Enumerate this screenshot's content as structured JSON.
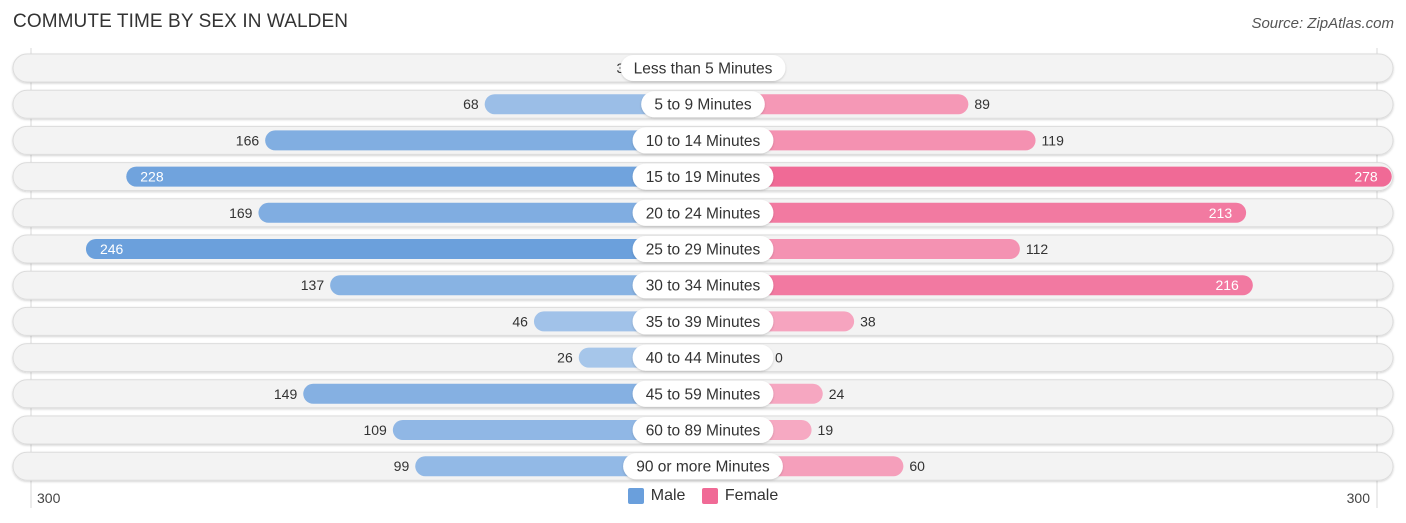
{
  "header": {
    "title": "COMMUTE TIME BY SEX IN WALDEN",
    "source": "Source: ZipAtlas.com"
  },
  "chart_data": {
    "type": "bar",
    "orientation": "horizontal-diverging",
    "title": "COMMUTE TIME BY SEX IN WALDEN",
    "categories": [
      "Less than 5 Minutes",
      "5 to 9 Minutes",
      "10 to 14 Minutes",
      "15 to 19 Minutes",
      "20 to 24 Minutes",
      "25 to 29 Minutes",
      "30 to 34 Minutes",
      "35 to 39 Minutes",
      "40 to 44 Minutes",
      "45 to 59 Minutes",
      "60 to 89 Minutes",
      "90 or more Minutes"
    ],
    "series": [
      {
        "name": "Male",
        "color": "#6a9fdc",
        "values": [
          3,
          68,
          166,
          228,
          169,
          246,
          137,
          46,
          26,
          149,
          109,
          99
        ]
      },
      {
        "name": "Female",
        "color": "#f06a96",
        "values": [
          0,
          89,
          119,
          278,
          213,
          112,
          216,
          38,
          0,
          24,
          19,
          60
        ]
      }
    ],
    "axis": {
      "left_label": "300",
      "right_label": "300",
      "range": [
        -300,
        300
      ]
    },
    "legend": {
      "position": "bottom-center",
      "items": [
        "Male",
        "Female"
      ]
    },
    "grid": false
  },
  "legend": {
    "male_label": "Male",
    "female_label": "Female",
    "male_color": "#6a9fdc",
    "female_color": "#f06a96"
  },
  "axis": {
    "left": "300",
    "right": "300"
  }
}
